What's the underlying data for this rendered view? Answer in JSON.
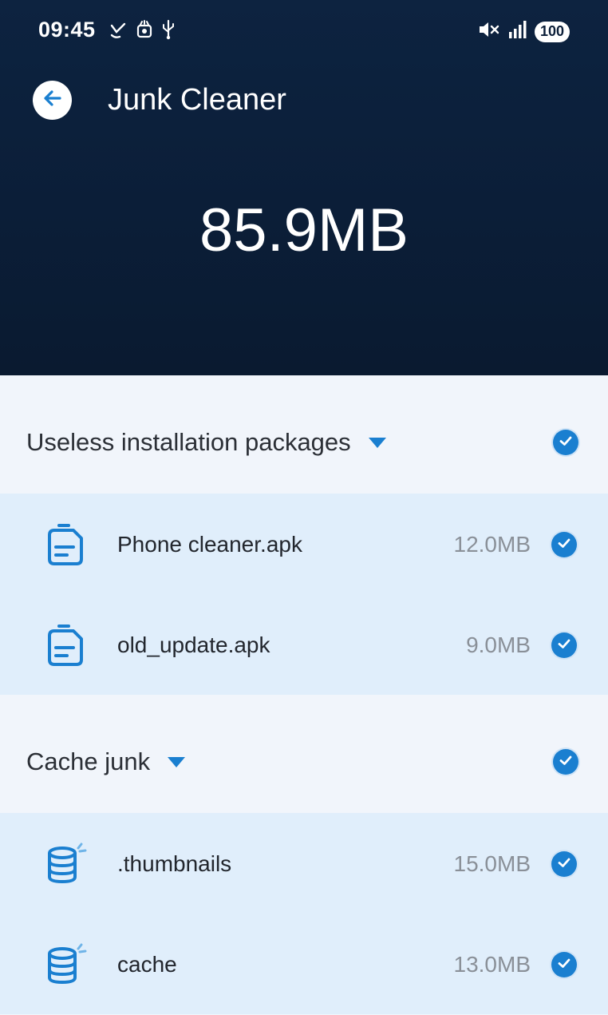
{
  "status_bar": {
    "time": "09:45",
    "battery": "100"
  },
  "header": {
    "title": "Junk Cleaner",
    "total_size": "85.9MB"
  },
  "groups": [
    {
      "label": "Useless installation packages",
      "checked": true,
      "items": [
        {
          "name": "Phone cleaner.apk",
          "size": "12.0MB",
          "icon": "apk-package-icon",
          "checked": true
        },
        {
          "name": "old_update.apk",
          "size": "9.0MB",
          "icon": "apk-package-icon",
          "checked": true
        }
      ]
    },
    {
      "label": "Cache junk",
      "checked": true,
      "items": [
        {
          "name": ".thumbnails",
          "size": "15.0MB",
          "icon": "database-icon",
          "checked": true
        },
        {
          "name": "cache",
          "size": "13.0MB",
          "icon": "database-icon",
          "checked": true
        }
      ]
    }
  ],
  "colors": {
    "header_bg": "#0b1e38",
    "accent": "#1a7fd0",
    "item_bg": "#e0eefb",
    "page_bg": "#f1f5fb"
  }
}
